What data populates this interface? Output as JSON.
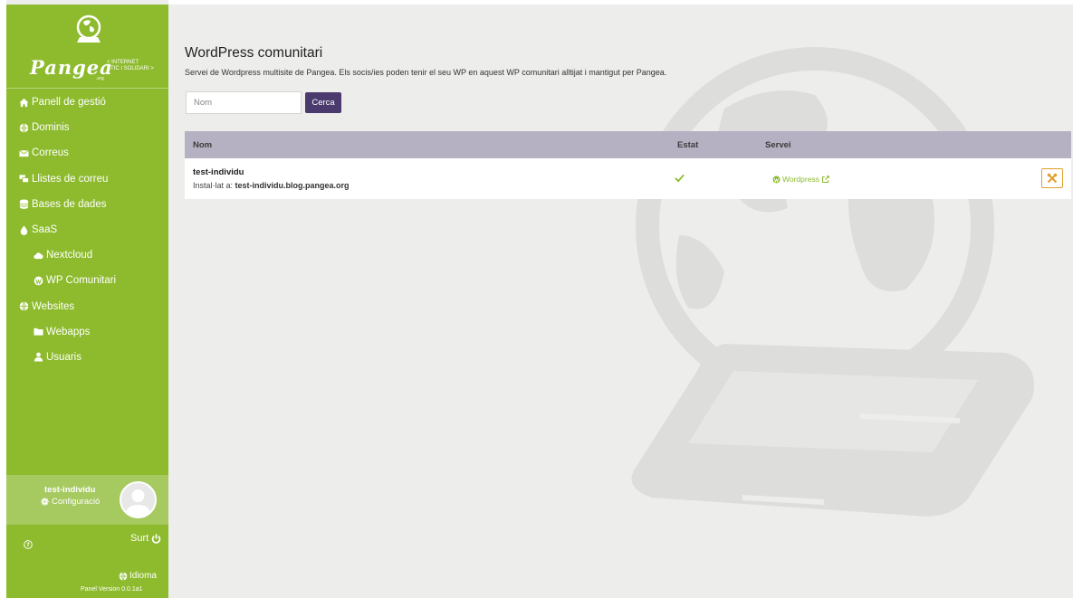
{
  "brand": {
    "name": "Pangea",
    "tagline_line1": "< INTERNET",
    "tagline_line2": "ÈTIC I SOLIDARI >",
    "suffix": ".org"
  },
  "colors": {
    "sidebar": "#8dbb2d",
    "accent_button": "#4a3a6e",
    "table_header": "#b6b1c2",
    "tool_border": "#e0a030"
  },
  "sidebar": {
    "items": [
      {
        "label": "Panell de gestió",
        "icon": "home-icon"
      },
      {
        "label": "Dominis",
        "icon": "globe-icon"
      },
      {
        "label": "Correus",
        "icon": "envelope-icon"
      },
      {
        "label": "Llistes de correu",
        "icon": "mailing-list-icon"
      },
      {
        "label": "Bases de dades",
        "icon": "database-icon"
      },
      {
        "label": "SaaS",
        "icon": "drop-icon"
      },
      {
        "label": "Nextcloud",
        "icon": "cloud-icon"
      },
      {
        "label": "WP Comunitari",
        "icon": "wordpress-icon"
      },
      {
        "label": "Websites",
        "icon": "globe-icon"
      },
      {
        "label": "Webapps",
        "icon": "folder-icon"
      },
      {
        "label": "Usuaris",
        "icon": "user-icon"
      }
    ],
    "user": {
      "name": "test-individu",
      "config_label": "Configuració"
    },
    "logout_label": "Surt",
    "language_label": "Idioma",
    "version": "Panel Version 0.0.1a1"
  },
  "main": {
    "title": "WordPress comunitari",
    "description": "Servei de Wordpress multisite de Pangea. Els socis/ies poden tenir el seu WP en aquest WP comunitari alltijat i mantigut per Pangea.",
    "search": {
      "placeholder": "Nom",
      "button_label": "Cerca"
    },
    "table": {
      "headers": {
        "name": "Nom",
        "status": "Estat",
        "service": "Servei"
      },
      "rows": [
        {
          "name": "test-individu",
          "installed_prefix": "Instal·lat a: ",
          "installed_url": "test-individu.blog.pangea.org",
          "status": "ok",
          "service": "Wordpress"
        }
      ]
    }
  }
}
